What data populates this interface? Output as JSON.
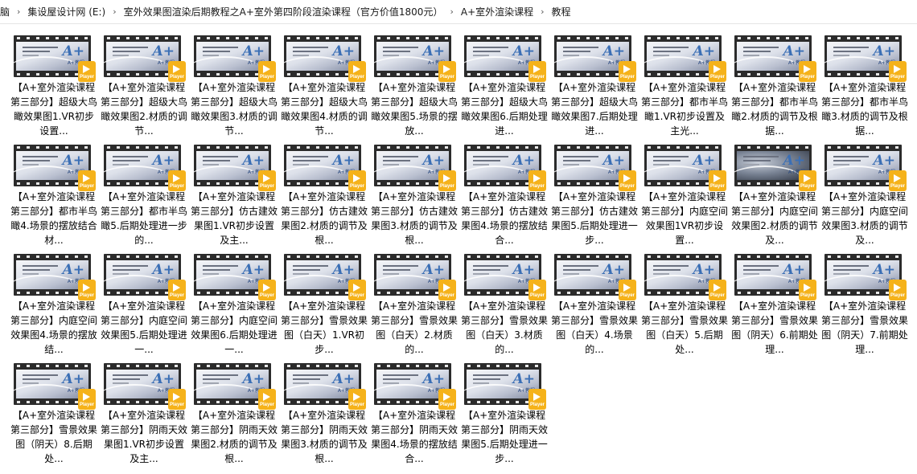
{
  "breadcrumb": [
    "脑",
    "集设屋设计网 (E:)",
    "室外效果图渲染后期教程之A+室外第四阶段渲染课程（官方价值1800元）",
    "A+室外渲染课程",
    "教程"
  ],
  "thumbnail": {
    "logo": "A+",
    "logo_sub": "A+教程",
    "badge": "Player",
    "badge_color": "#f5b21a"
  },
  "files": [
    {
      "label": "【A+室外渲染课程第三部分】超级大鸟瞰效果图1.VR初步设置..."
    },
    {
      "label": "【A+室外渲染课程第三部分】超级大鸟瞰效果图2.材质的调节..."
    },
    {
      "label": "【A+室外渲染课程第三部分】超级大鸟瞰效果图3.材质的调节..."
    },
    {
      "label": "【A+室外渲染课程第三部分】超级大鸟瞰效果图4.材质的调节..."
    },
    {
      "label": "【A+室外渲染课程第三部分】超级大鸟瞰效果图5.场景的摆放..."
    },
    {
      "label": "【A+室外渲染课程第三部分】超级大鸟瞰效果图6.后期处理进..."
    },
    {
      "label": "【A+室外渲染课程第三部分】超级大鸟瞰效果图7.后期处理进..."
    },
    {
      "label": "【A+室外渲染课程第三部分】都市半鸟瞰1.VR初步设置及主光..."
    },
    {
      "label": "【A+室外渲染课程第三部分】都市半鸟瞰2.材质的调节及根据..."
    },
    {
      "label": "【A+室外渲染课程第三部分】都市半鸟瞰3.材质的调节及根据..."
    },
    {
      "label": "【A+室外渲染课程第三部分】都市半鸟瞰4.场景的摆放结合材..."
    },
    {
      "label": "【A+室外渲染课程第三部分】都市半鸟瞰5.后期处理进一步的..."
    },
    {
      "label": "【A+室外渲染课程第三部分】仿古建效果图1.VR初步设置及主..."
    },
    {
      "label": "【A+室外渲染课程第三部分】仿古建效果图2.材质的调节及根..."
    },
    {
      "label": "【A+室外渲染课程第三部分】仿古建效果图3.材质的调节及根..."
    },
    {
      "label": "【A+室外渲染课程第三部分】仿古建效果图4.场景的摆放结合..."
    },
    {
      "label": "【A+室外渲染课程第三部分】仿古建效果图5.后期处理进一步..."
    },
    {
      "label": "【A+室外渲染课程第三部分】内庭空间效果图1VR初步设置..."
    },
    {
      "label": "【A+室外渲染课程第三部分】内庭空间效果图2.材质的调节及..."
    },
    {
      "label": "【A+室外渲染课程第三部分】内庭空间效果图3.材质的调节及..."
    },
    {
      "label": "【A+室外渲染课程第三部分】内庭空间效果图4.场景的摆放结..."
    },
    {
      "label": "【A+室外渲染课程第三部分】内庭空间效果图5.后期处理进一..."
    },
    {
      "label": "【A+室外渲染课程第三部分】内庭空间效果图6.后期处理进一..."
    },
    {
      "label": "【A+室外渲染课程第三部分】雪景效果图（白天）1.VR初步..."
    },
    {
      "label": "【A+室外渲染课程第三部分】雪景效果图（白天）2.材质的..."
    },
    {
      "label": "【A+室外渲染课程第三部分】雪景效果图（白天）3.材质的..."
    },
    {
      "label": "【A+室外渲染课程第三部分】雪景效果图（白天）4.场景的..."
    },
    {
      "label": "【A+室外渲染课程第三部分】雪景效果图（白天）5.后期处..."
    },
    {
      "label": "【A+室外渲染课程第三部分】雪景效果图（阴天）6.前期处理..."
    },
    {
      "label": "【A+室外渲染课程第三部分】雪景效果图（阴天）7.前期处理..."
    },
    {
      "label": "【A+室外渲染课程第三部分】雪景效果图（阴天）8.后期处..."
    },
    {
      "label": "【A+室外渲染课程第三部分】阴雨天效果图1.VR初步设置及主..."
    },
    {
      "label": "【A+室外渲染课程第三部分】阴雨天效果图2.材质的调节及根..."
    },
    {
      "label": "【A+室外渲染课程第三部分】阴雨天效果图3.材质的调节及根..."
    },
    {
      "label": "【A+室外渲染课程第三部分】阴雨天效果图4.场景的摆放结合..."
    },
    {
      "label": "【A+室外渲染课程第三部分】阴雨天效果图5.后期处理进一步..."
    }
  ]
}
